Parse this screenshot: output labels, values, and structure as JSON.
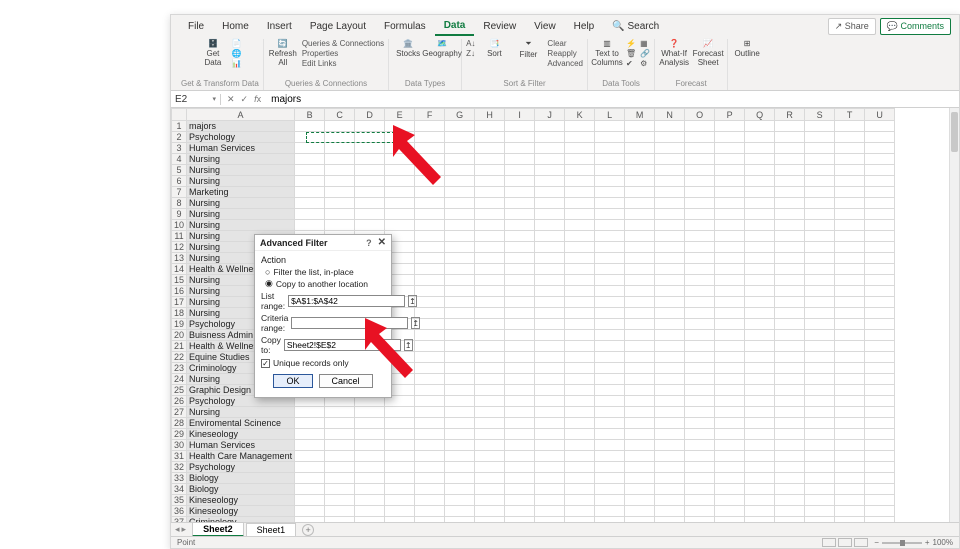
{
  "tabs": [
    "File",
    "Home",
    "Insert",
    "Page Layout",
    "Formulas",
    "Data",
    "Review",
    "View",
    "Help"
  ],
  "active_tab_index": 5,
  "search_label": "Search",
  "share_label": "Share",
  "comments_label": "Comments",
  "ribbon": {
    "get_data": "Get\nData",
    "refresh": "Refresh\nAll",
    "queries_conn": "Queries & Connections",
    "properties": "Properties",
    "edit_links": "Edit Links",
    "stocks": "Stocks",
    "geography": "Geography",
    "sort": "Sort",
    "filter": "Filter",
    "clear": "Clear",
    "reapply": "Reapply",
    "advanced": "Advanced",
    "text_to_cols": "Text to\nColumns",
    "whatif": "What-If\nAnalysis",
    "forecast_sheet": "Forecast\nSheet",
    "outline": "Outline",
    "group_labels": {
      "get_transform": "Get & Transform Data",
      "queries_conn": "Queries & Connections",
      "data_types": "Data Types",
      "sort_filter": "Sort & Filter",
      "data_tools": "Data Tools",
      "forecast": "Forecast"
    }
  },
  "namebox": "E2",
  "formula": "majors",
  "columns": [
    "A",
    "B",
    "C",
    "D",
    "E",
    "F",
    "G",
    "H",
    "I",
    "J",
    "K",
    "L",
    "M",
    "N",
    "O",
    "P",
    "Q",
    "R",
    "S",
    "T",
    "U"
  ],
  "rows": [
    "majors",
    "Psychology",
    "Human Services",
    "Nursing",
    "Nursing",
    "Nursing",
    "Marketing",
    "Nursing",
    "Nursing",
    "Nursing",
    "Nursing",
    "Nursing",
    "Nursing",
    "Health & Wellness",
    "Nursing",
    "Nursing",
    "Nursing",
    "Nursing",
    "Psychology",
    "Buisness Admin",
    "Health & Wellness",
    "Equine Studies",
    "Criminology",
    "Nursing",
    "Graphic Design",
    "Psychology",
    "Nursing",
    "Enviromental Scinence",
    "Kineseology",
    "Human Services",
    "Health Care Management",
    "Psychology",
    "Biology",
    "Biology",
    "Kineseology",
    "Kineseology",
    "Criminology"
  ],
  "dialog": {
    "title": "Advanced Filter",
    "action_label": "Action",
    "radio_filter": "Filter the list, in-place",
    "radio_copy": "Copy to another location",
    "list_range_label": "List range:",
    "list_range_value": "$A$1:$A$42",
    "criteria_label": "Criteria range:",
    "criteria_value": "",
    "copy_to_label": "Copy to:",
    "copy_to_value": "Sheet2!$E$2",
    "unique_label": "Unique records only",
    "ok": "OK",
    "cancel": "Cancel"
  },
  "sheets": [
    "Sheet2",
    "Sheet1"
  ],
  "active_sheet_index": 0,
  "status_left": "Point",
  "zoom": "100%"
}
